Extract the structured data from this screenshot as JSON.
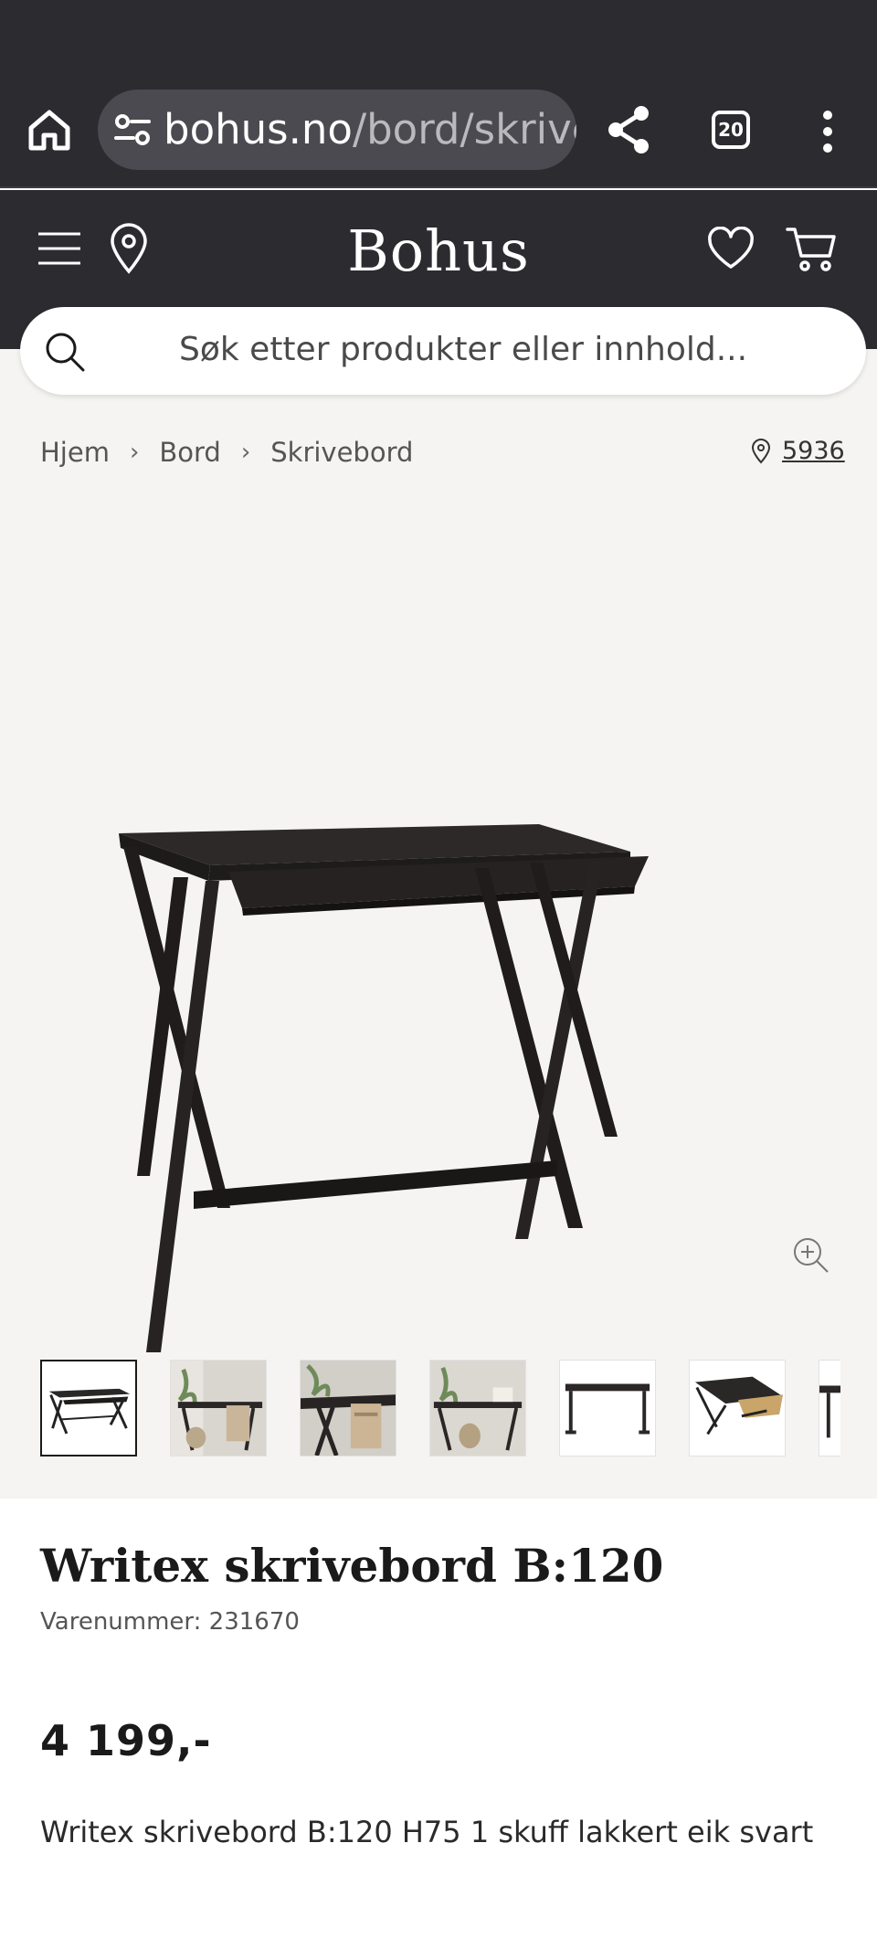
{
  "browser": {
    "url_domain": "bohus.no",
    "url_path": "/bord/skrive",
    "tab_count": "20"
  },
  "header": {
    "logo": "Bohus"
  },
  "search": {
    "placeholder": "Søk etter produkter eller innhold..."
  },
  "breadcrumb": {
    "items": [
      "Hjem",
      "Bord",
      "Skrivebord"
    ],
    "separator": "›"
  },
  "store": {
    "number": "5936"
  },
  "gallery": {
    "thumbnail_count": 7,
    "active_index": 0
  },
  "product": {
    "title": "Writex skrivebord B:120",
    "sku": "Varenummer: 231670",
    "price": "4 199,-",
    "description": "Writex skrivebord B:120 H75 1 skuff lakkert eik svart"
  },
  "colors": {
    "header_bg": "#2b2b30",
    "gallery_bg": "#f5f4f2",
    "desk_color": "#232020"
  }
}
